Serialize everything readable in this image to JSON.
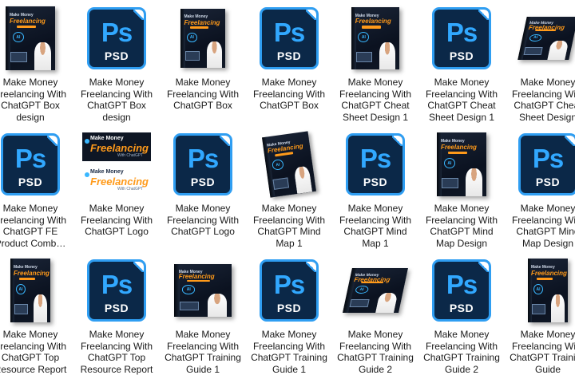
{
  "window": {
    "title": ""
  },
  "files": [
    {
      "name": "Make Money Freelancing With ChatGPT Box design",
      "type": "mockup",
      "thumb": "box-upright",
      "icon": "box-design-thumbnail"
    },
    {
      "name": "Make Money Freelancing With ChatGPT Box design",
      "type": "psd",
      "badge": "Ps",
      "ext": "PSD",
      "icon": "psd-file-icon"
    },
    {
      "name": "Make Money Freelancing With ChatGPT Box",
      "type": "mockup",
      "thumb": "box-3d",
      "icon": "box-thumbnail"
    },
    {
      "name": "Make Money Freelancing With ChatGPT Box",
      "type": "psd",
      "badge": "Ps",
      "ext": "PSD",
      "icon": "psd-file-icon"
    },
    {
      "name": "Make Money Freelancing With ChatGPT Cheat Sheet Design 1",
      "type": "mockup",
      "thumb": "sheet",
      "icon": "cheat-sheet-thumbnail"
    },
    {
      "name": "Make Money Freelancing With ChatGPT Cheat Sheet Design 1",
      "type": "psd",
      "badge": "Ps",
      "ext": "PSD",
      "icon": "psd-file-icon"
    },
    {
      "name": "Make Money Freelancing With ChatGPT Cheat Sheet Design",
      "type": "mockup",
      "thumb": "sheet-angled",
      "icon": "cheat-sheet-thumbnail"
    },
    {
      "name": "Make Money Freelancing With ChatGPT FE Product Comb…",
      "type": "psd",
      "badge": "Ps",
      "ext": "PSD",
      "icon": "psd-file-icon"
    },
    {
      "name": "Make Money Freelancing With ChatGPT Logo",
      "type": "logo",
      "thumb": "logo",
      "icon": "logo-thumbnail",
      "logo": {
        "top_line": "Make Money",
        "main": "Freelancing",
        "sub": "With ChatGPT"
      }
    },
    {
      "name": "Make Money Freelancing With ChatGPT Logo",
      "type": "psd",
      "badge": "Ps",
      "ext": "PSD",
      "icon": "psd-file-icon"
    },
    {
      "name": "Make Money Freelancing With ChatGPT Mind Map 1",
      "type": "mockup",
      "thumb": "book-angled",
      "icon": "mind-map-thumbnail"
    },
    {
      "name": "Make Money Freelancing With ChatGPT Mind Map 1",
      "type": "psd",
      "badge": "Ps",
      "ext": "PSD",
      "icon": "psd-file-icon"
    },
    {
      "name": "Make Money Freelancing With ChatGPT Mind Map Design",
      "type": "mockup",
      "thumb": "box-upright",
      "icon": "mind-map-thumbnail"
    },
    {
      "name": "Make Money Freelancing With ChatGPT Mind Map Design",
      "type": "psd",
      "badge": "Ps",
      "ext": "PSD",
      "icon": "psd-file-icon"
    },
    {
      "name": "Make Money Freelancing With ChatGPT Top Resource Report",
      "type": "mockup",
      "thumb": "book-upright",
      "icon": "report-thumbnail"
    },
    {
      "name": "Make Money Freelancing With ChatGPT Top Resource Report",
      "type": "psd",
      "badge": "Ps",
      "ext": "PSD",
      "icon": "psd-file-icon"
    },
    {
      "name": "Make Money Freelancing With ChatGPT Training Guide 1",
      "type": "mockup",
      "thumb": "box-set",
      "icon": "training-guide-thumbnail"
    },
    {
      "name": "Make Money Freelancing With ChatGPT Training Guide 1",
      "type": "psd",
      "badge": "Ps",
      "ext": "PSD",
      "icon": "psd-file-icon"
    },
    {
      "name": "Make Money Freelancing With ChatGPT Training Guide 2",
      "type": "mockup",
      "thumb": "book-flat",
      "icon": "training-guide-thumbnail"
    },
    {
      "name": "Make Money Freelancing With ChatGPT Training Guide 2",
      "type": "psd",
      "badge": "Ps",
      "ext": "PSD",
      "icon": "psd-file-icon"
    },
    {
      "name": "Make Money Freelancing With ChatGPT Training Guide",
      "type": "mockup",
      "thumb": "book-upright",
      "icon": "training-guide-thumbnail"
    }
  ],
  "mockup_text": {
    "line1": "Make Money",
    "line2": "Freelancing",
    "badge": "AI"
  },
  "colors": {
    "psd_bg": "#0b2848",
    "psd_accent": "#31a8ff",
    "brand_orange": "#ff9a1a"
  }
}
